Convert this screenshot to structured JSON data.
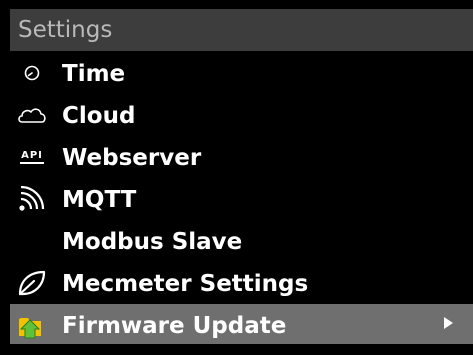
{
  "title": "Settings",
  "menu": {
    "items": [
      {
        "label": "Time",
        "icon": "clock-icon"
      },
      {
        "label": "Cloud",
        "icon": "cloud-icon"
      },
      {
        "label": "Webserver",
        "icon": "api-icon",
        "icon_text": "API"
      },
      {
        "label": "MQTT",
        "icon": "wifi-signal-icon"
      },
      {
        "label": "Modbus Slave",
        "icon": ""
      },
      {
        "label": "Mecmeter Settings",
        "icon": "leaf-icon"
      },
      {
        "label": "Firmware Update",
        "icon": "update-folder-icon",
        "selected": true
      }
    ]
  },
  "colors": {
    "background": "#000000",
    "title_bar": "#3d3d3d",
    "title_text": "#b9b9b9",
    "selected_bg": "#6f6f6f",
    "update_arrow": "#5fc13a",
    "folder": "#f2c200"
  }
}
